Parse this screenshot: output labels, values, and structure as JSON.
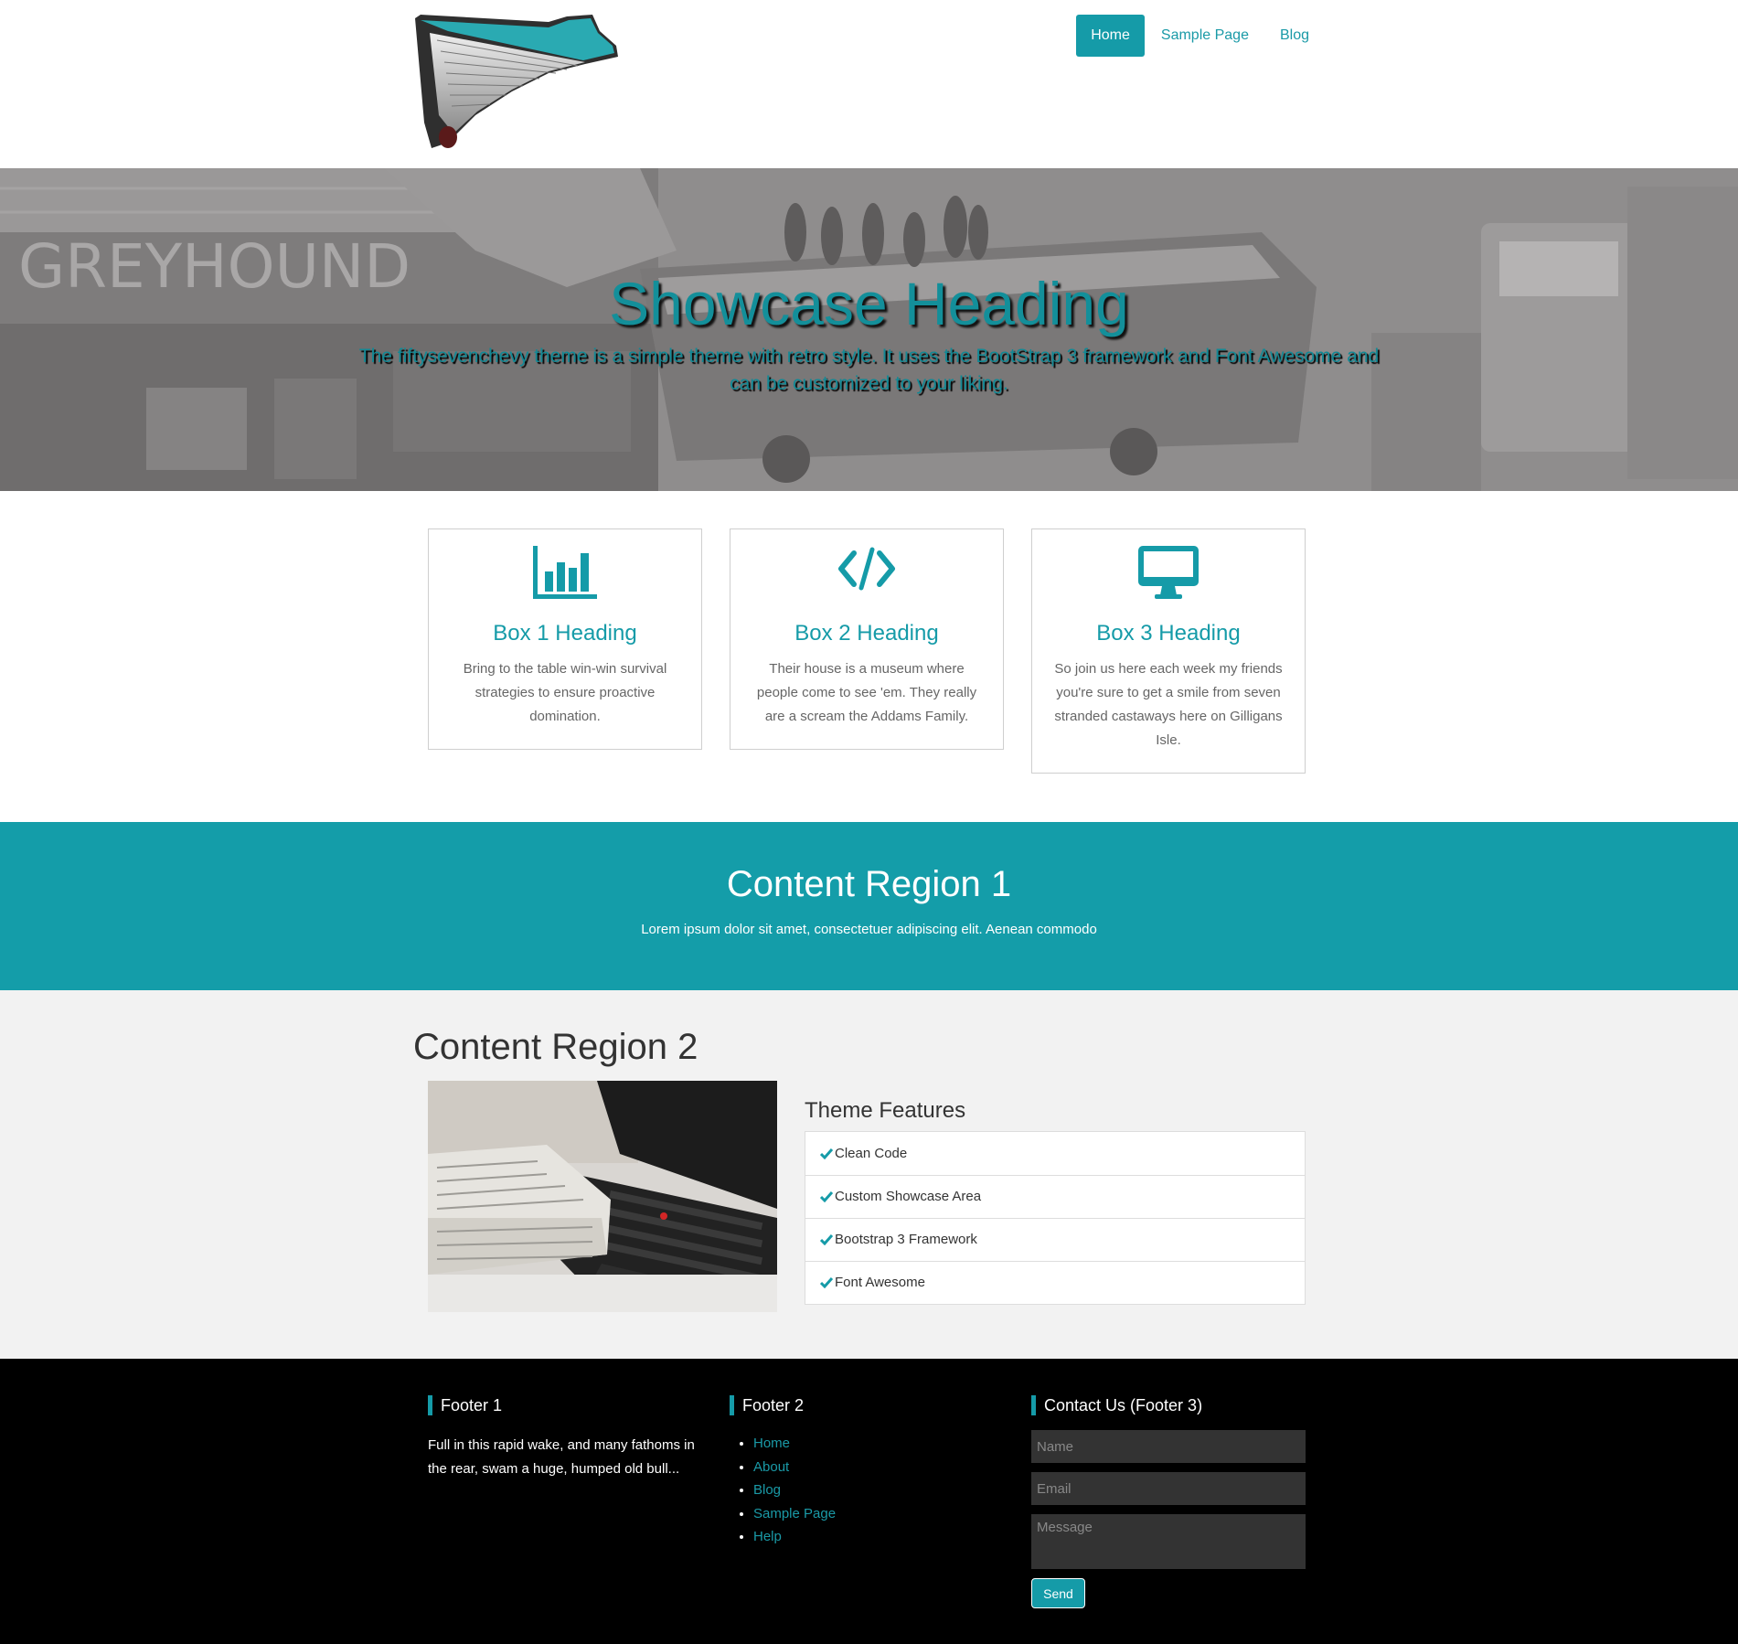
{
  "nav": {
    "items": [
      {
        "label": "Home",
        "active": true
      },
      {
        "label": "Sample Page",
        "active": false
      },
      {
        "label": "Blog",
        "active": false
      }
    ]
  },
  "showcase": {
    "heading": "Showcase Heading",
    "text": "The fiftysevenchevy theme is a simple theme with retro style. It uses the BootStrap 3 framework and Font Awesome and can be customized to your liking.",
    "sign_text": "GREYHOUND"
  },
  "boxes": [
    {
      "icon": "bar-chart-icon",
      "heading": "Box 1 Heading",
      "text": "Bring to the table win-win survival strategies to ensure proactive domination."
    },
    {
      "icon": "code-icon",
      "heading": "Box 2 Heading",
      "text": "Their house is a museum where people come to see 'em. They really are a scream the Addams Family."
    },
    {
      "icon": "desktop-icon",
      "heading": "Box 3 Heading",
      "text": "So join us here each week my friends you're sure to get a smile from seven stranded castaways here on Gilligans Isle."
    }
  ],
  "region1": {
    "heading": "Content Region 1",
    "text": "Lorem ipsum dolor sit amet, consectetuer adipiscing elit. Aenean commodo"
  },
  "region2": {
    "heading": "Content Region 2",
    "features_heading": "Theme Features",
    "features": [
      "Clean Code",
      "Custom Showcase Area",
      "Bootstrap 3 Framework",
      "Font Awesome"
    ]
  },
  "footer": {
    "col1": {
      "heading": "Footer 1",
      "text": "Full in this rapid wake, and many fathoms in the rear, swam a huge, humped old bull..."
    },
    "col2": {
      "heading": "Footer 2",
      "links": [
        "Home",
        "About",
        "Blog",
        "Sample Page",
        "Help"
      ]
    },
    "col3": {
      "heading": "Contact Us (Footer 3)",
      "name_placeholder": "Name",
      "email_placeholder": "Email",
      "message_placeholder": "Message",
      "send_label": "Send"
    }
  },
  "colors": {
    "accent": "#159ba8",
    "footer_bg": "#000000",
    "region2_bg": "#f2f2f2"
  }
}
